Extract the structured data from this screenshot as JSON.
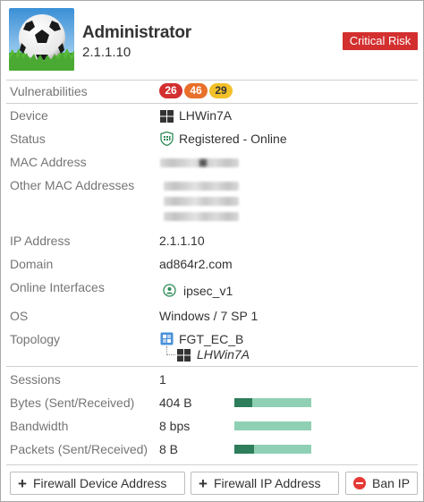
{
  "header": {
    "name": "Administrator",
    "ip": "2.1.1.10",
    "risk_label": "Critical Risk",
    "risk_color": "#d32f2f"
  },
  "vulnerabilities": {
    "label": "Vulnerabilities",
    "badges": [
      {
        "count": "26",
        "color": "#d32f2f",
        "text_color": "#ffffff"
      },
      {
        "count": "46",
        "color": "#e8702a",
        "text_color": "#ffffff"
      },
      {
        "count": "29",
        "color": "#f2c029",
        "text_color": "#333333"
      }
    ]
  },
  "fields": {
    "device": {
      "label": "Device",
      "value": "LHWin7A",
      "icon": "windows-icon"
    },
    "status": {
      "label": "Status",
      "value": "Registered - Online",
      "icon": "forticlient-shield-icon"
    },
    "mac": {
      "label": "MAC Address"
    },
    "other_mac": {
      "label": "Other MAC Addresses"
    },
    "ip": {
      "label": "IP Address",
      "value": "2.1.1.10"
    },
    "domain": {
      "label": "Domain",
      "value": "ad864r2.com"
    },
    "interfaces": {
      "label": "Online Interfaces",
      "value": "ipsec_v1",
      "icon": "vpn-interface-icon"
    },
    "os": {
      "label": "OS",
      "value": "Windows / 7 SP 1"
    },
    "topology": {
      "label": "Topology",
      "parent": "FGT_EC_B",
      "child": "LHWin7A",
      "parent_icon": "fortigate-icon",
      "child_icon": "windows-icon"
    }
  },
  "traffic": {
    "sessions": {
      "label": "Sessions",
      "value": "1"
    },
    "bytes": {
      "label": "Bytes (Sent/Received)",
      "value": "404 B",
      "sent_fraction": 0.23
    },
    "bandwidth": {
      "label": "Bandwidth",
      "value": "8 bps",
      "sent_fraction": 0.0
    },
    "packets": {
      "label": "Packets (Sent/Received)",
      "value": "8 B",
      "sent_fraction": 0.25
    }
  },
  "actions": {
    "firewall_device": "Firewall Device Address",
    "firewall_ip": "Firewall IP Address",
    "ban_ip": "Ban IP"
  },
  "colors": {
    "bar_sent": "#2e7d5b",
    "bar_received": "#8fd0b4"
  }
}
